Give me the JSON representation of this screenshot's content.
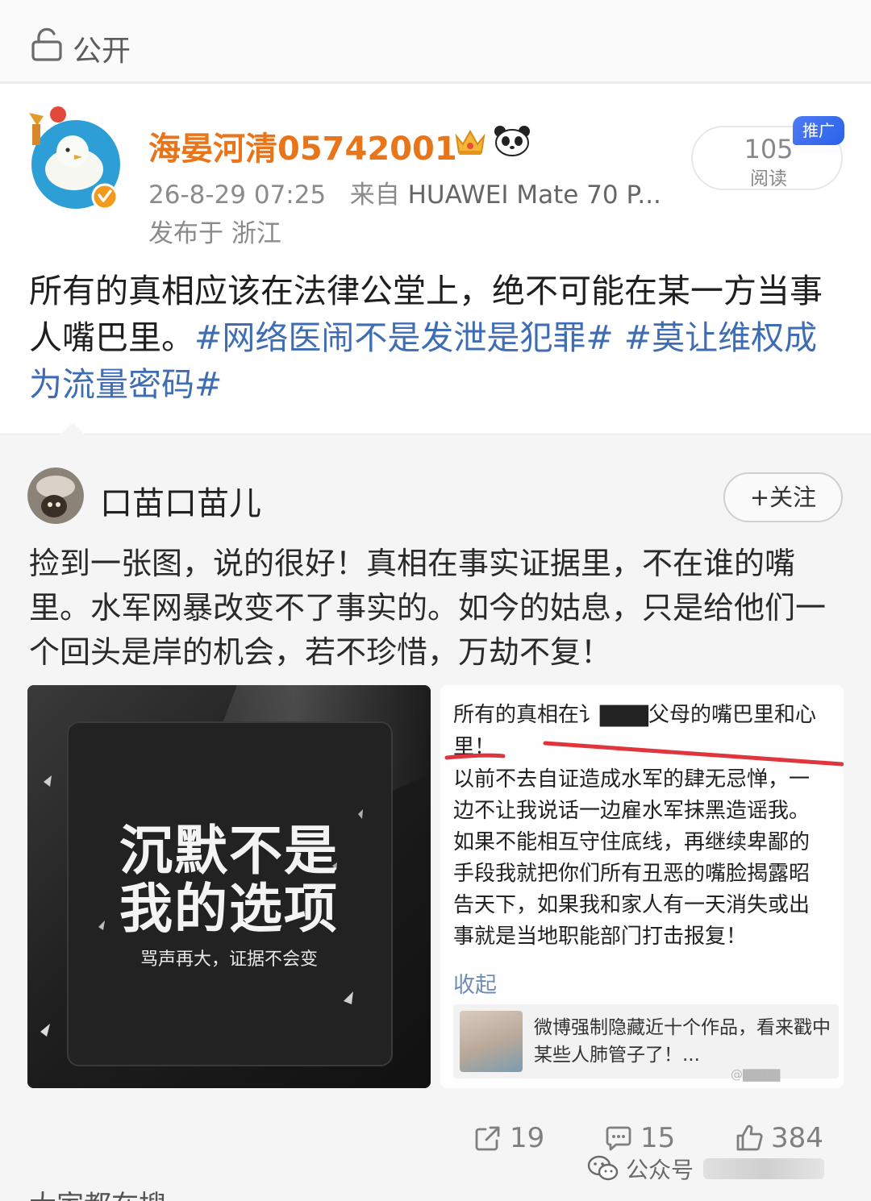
{
  "privacy": {
    "label": "公开"
  },
  "post": {
    "username": "海晏河清05742001",
    "timestamp": "26-8-29 07:25",
    "source_prefix": "来自",
    "device": "HUAWEI Mate 70 P...",
    "location": "发布于 浙江",
    "read_count": "105",
    "read_label": "阅读",
    "promo_badge": "推广",
    "text": "所有的真相应该在法律公堂上，绝不可能在某一方当事人嘴巴里。",
    "hashtags": [
      "#网络医闹不是发泄是犯罪#",
      "#莫让维权成为流量密码#"
    ]
  },
  "repost": {
    "username": "口苗口苗儿",
    "follow_label": "+关注",
    "text": "捡到一张图，说的很好！真相在事实证据里，不在谁的嘴里。水军网暴改变不了事实的。如今的姑息，只是给他们一个回头是岸的机会，若不珍惜，万劫不复！",
    "poster": {
      "title_line1": "沉默不是",
      "title_line2": "我的选项",
      "subtitle": "骂声再大，证据不会变"
    },
    "screenshot": {
      "lines": [
        "所有的真相在讠▇▇▇父母的嘴巴里和心",
        "里！",
        "以前不去自证造成水军的肆无忌惮，一",
        "边不让我说话一边雇水军抹黑造谣我。",
        "如果不能相互守住底线，再继续卑鄙的",
        "手段我就把你们所有丑恶的嘴脸揭露昭",
        "告天下，如果我和家人有一天消失或出",
        "事就是当地职能部门打击报复！"
      ],
      "collapse_label": "收起",
      "card_text": "微博强制隐藏近十个作品，看来戳中某些人肺管子了！...",
      "watermark": "@▇▇▇▇"
    }
  },
  "actions": {
    "share_count": "19",
    "comment_count": "15",
    "like_count": "384"
  },
  "watermark": {
    "label": "公众号"
  },
  "bottom": {
    "text": "大家都在搜"
  },
  "colors": {
    "username": "#e8751a",
    "hashtag": "#3f6db3",
    "promo": "#2a62e8",
    "repost_bg": "#f5f5f5"
  }
}
